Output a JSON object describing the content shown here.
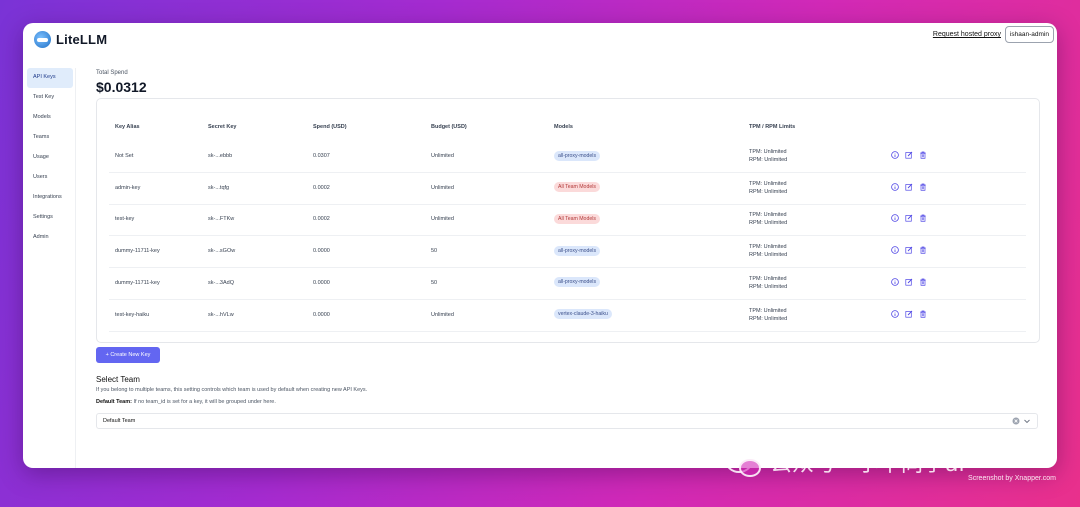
{
  "app": {
    "name": "LiteLLM",
    "hosted_link": "Request hosted proxy",
    "user": "ishaan-admin"
  },
  "sidebar": {
    "items": [
      {
        "label": "API Keys",
        "active": true
      },
      {
        "label": "Test Key"
      },
      {
        "label": "Models"
      },
      {
        "label": "Teams"
      },
      {
        "label": "Usage"
      },
      {
        "label": "Users"
      },
      {
        "label": "Integrations"
      },
      {
        "label": "Settings"
      },
      {
        "label": "Admin"
      }
    ]
  },
  "spend": {
    "label": "Total Spend",
    "value": "$0.0312"
  },
  "table": {
    "headers": [
      "Key Alias",
      "Secret Key",
      "Spend (USD)",
      "Budget (USD)",
      "Models",
      "TPM / RPM Limits"
    ],
    "rows": [
      {
        "alias": "Not Set",
        "secret": "sk-...ebbb",
        "spend": "0.0307",
        "budget": "Unlimited",
        "model": "all-proxy-models",
        "model_style": "blue",
        "tpm": "TPM: Unlimited",
        "rpm": "RPM: Unlimited"
      },
      {
        "alias": "admin-key",
        "secret": "sk-...tqfg",
        "spend": "0.0002",
        "budget": "Unlimited",
        "model": "All Team Models",
        "model_style": "red",
        "tpm": "TPM: Unlimited",
        "rpm": "RPM: Unlimited"
      },
      {
        "alias": "test-key",
        "secret": "sk-...FTKw",
        "spend": "0.0002",
        "budget": "Unlimited",
        "model": "All Team Models",
        "model_style": "red",
        "tpm": "TPM: Unlimited",
        "rpm": "RPM: Unlimited"
      },
      {
        "alias": "dummy-11711-key",
        "secret": "sk-...sGOw",
        "spend": "0.0000",
        "budget": "50",
        "model": "all-proxy-models",
        "model_style": "blue",
        "tpm": "TPM: Unlimited",
        "rpm": "RPM: Unlimited"
      },
      {
        "alias": "dummy-11711-key",
        "secret": "sk-...3AdQ",
        "spend": "0.0000",
        "budget": "50",
        "model": "all-proxy-models",
        "model_style": "blue",
        "tpm": "TPM: Unlimited",
        "rpm": "RPM: Unlimited"
      },
      {
        "alias": "test-key-haiku",
        "secret": "sk-...hVLw",
        "spend": "0.0000",
        "budget": "Unlimited",
        "model": "vertex-claude-3-haiku",
        "model_style": "blue",
        "tpm": "TPM: Unlimited",
        "rpm": "RPM: Unlimited"
      }
    ]
  },
  "create_button": "+ Create New Key",
  "team_select": {
    "title": "Select Team",
    "description": "If you belong to multiple teams, this setting controls which team is used by default when creating new API Keys.",
    "default_label": "Default Team:",
    "default_note": " If no team_id is set for a key, it will be grouped under here.",
    "value": "Default Team"
  },
  "icons": {
    "info": "info-icon",
    "edit": "edit-icon",
    "delete": "trash-icon"
  },
  "colors": {
    "accent": "#6366f1",
    "pill_blue": "#dbe7fb",
    "pill_red": "#fbdada"
  },
  "overlay": {
    "watermark": "公众号 · 小华同学ai",
    "credit": "Screenshot by Xnapper.com"
  }
}
